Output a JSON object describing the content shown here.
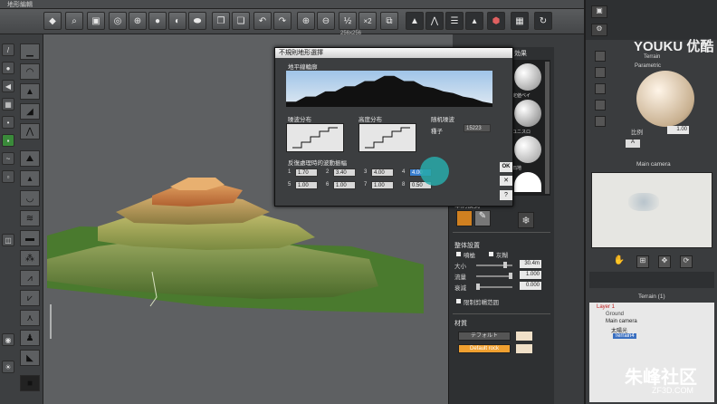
{
  "window": {
    "title": "地形編輯"
  },
  "toolbar": {
    "zoom_half": "½",
    "zoom_double": "×2",
    "dimension_label": "256x256"
  },
  "dialog": {
    "title": "不規則地形選擇",
    "horizon_label": "地平線輪廓",
    "wave_dist_label": "噪波分布",
    "height_dist_label": "高度分布",
    "random_noise_label": "随机噪波",
    "seed_label": "種子",
    "seed_value": "15223",
    "repeat_label": "反復處理時的波動振幅",
    "amplitude_rows": [
      [
        {
          "n": "1",
          "v": "1.70"
        },
        {
          "n": "2",
          "v": "3.40"
        },
        {
          "n": "3",
          "v": "4.00"
        },
        {
          "n": "4",
          "v": "4.00"
        }
      ],
      [
        {
          "n": "5",
          "v": "1.00"
        },
        {
          "n": "6",
          "v": "1.00"
        },
        {
          "n": "7",
          "v": "1.00"
        },
        {
          "n": "8",
          "v": "0.50"
        }
      ]
    ],
    "ok_label": "OK",
    "close_label": "✕",
    "help_label": "?"
  },
  "effects": {
    "tab_label": "効果",
    "thumbs": [
      "定値ベイ",
      "ユニスロ",
      "石地",
      ""
    ]
  },
  "brush": {
    "mode_label": "筆刷模式"
  },
  "global_settings": {
    "title": "整体設置",
    "opt_smooth": "噴槍",
    "opt_gray": "灰糊",
    "size_label": "大小",
    "size_value": "30.4m",
    "flow_label": "流量",
    "flow_value": "1.000",
    "fade_label": "衰減",
    "fade_value": "0.000",
    "limit_label": "限制剪輯范囲"
  },
  "material": {
    "title": "材質",
    "default_label": "テフォルト",
    "rock_label": "Default rock"
  },
  "right_panel": {
    "terrain_title": "Terrain",
    "preview_label": "Parametric",
    "ratio_label": "比例",
    "ratio_value": "1.00",
    "mode_value": "A",
    "camera_title": "Main camera",
    "object_title": "Terrain (1)",
    "tree": [
      "Layer 1",
      "Ground",
      "Main camera",
      "太陽光",
      "Terrain4"
    ]
  },
  "watermarks": {
    "youku": "YOUKU 优酷",
    "site": "朱峰社区",
    "site_url": "ZF3D.COM"
  },
  "chart_data": {
    "horizon_profile": [
      0.15,
      0.15,
      0.3,
      0.3,
      0.45,
      0.45,
      0.6,
      0.6,
      0.75,
      0.75,
      0.9,
      0.9,
      0.75,
      0.75,
      0.6,
      0.55,
      0.45,
      0.4,
      0.3,
      0.25,
      0.15,
      0.1
    ]
  },
  "colors": {
    "accent": "#3a7fd0",
    "rock_button": "#f0a030",
    "terrain_top": "#d89a5a",
    "ground": "#4a7a30"
  }
}
